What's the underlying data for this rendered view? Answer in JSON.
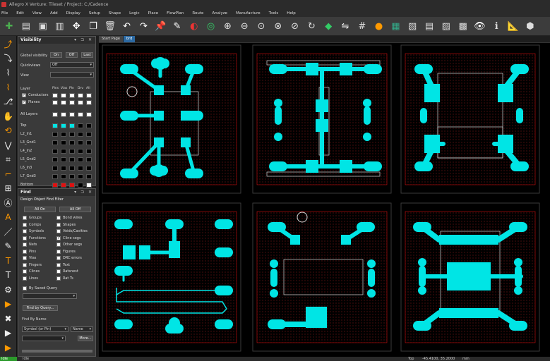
{
  "window": {
    "title": "Allegro X Venture: Tileset / Project: C:/Cadence"
  },
  "menu": [
    "File",
    "Edit",
    "View",
    "Add",
    "Display",
    "Setup",
    "Shape",
    "Logic",
    "Place",
    "FlowPlan",
    "Route",
    "Analyze",
    "Manufacture",
    "Tools",
    "Help"
  ],
  "tabs": [
    {
      "label": "Start Page",
      "active": false
    },
    {
      "label": "brd",
      "active": true
    }
  ],
  "visibility": {
    "title": "Visibility",
    "global_label": "Global visibility",
    "on": "On",
    "off": "Off",
    "last": "Last",
    "quickviews_label": "Quickviews",
    "quickviews_value": "Off",
    "view_label": "View",
    "view_value": "",
    "layer_label": "Layer",
    "cols": [
      "Pins",
      "Vias",
      "Pln",
      "Drv",
      "All"
    ],
    "conductors": "Conductors",
    "planes": "Planes",
    "all_layers": "All Layers",
    "layers": [
      {
        "name": "Top",
        "colors": [
          "#00e5e5",
          "#00e5e5",
          "#00e5e5",
          "#000000",
          "#000000"
        ]
      },
      {
        "name": "L2_In1",
        "colors": [
          "#000000",
          "#000000",
          "#000000",
          "#000000",
          "#000000"
        ]
      },
      {
        "name": "L3_Gnd1",
        "colors": [
          "#000000",
          "#000000",
          "#000000",
          "#000000",
          "#000000"
        ]
      },
      {
        "name": "L4_In2",
        "colors": [
          "#000000",
          "#000000",
          "#000000",
          "#000000",
          "#000000"
        ]
      },
      {
        "name": "L5_Gnd2",
        "colors": [
          "#000000",
          "#000000",
          "#000000",
          "#000000",
          "#000000"
        ]
      },
      {
        "name": "L6_In3",
        "colors": [
          "#000000",
          "#000000",
          "#000000",
          "#000000",
          "#000000"
        ]
      },
      {
        "name": "L7_Gnd3",
        "colors": [
          "#000000",
          "#000000",
          "#000000",
          "#000000",
          "#000000"
        ]
      },
      {
        "name": "Bottom",
        "colors": [
          "#e01010",
          "#e01010",
          "#e01010",
          "#000000",
          "#ffffff"
        ]
      }
    ]
  },
  "find": {
    "title": "Find",
    "filter_title": "Design Object Find Filter",
    "all_on": "All On",
    "all_off": "All Off",
    "left": [
      "Groups",
      "Comps",
      "Symbols",
      "Functions",
      "Nets",
      "Pins",
      "Vias",
      "Fingers",
      "Clines",
      "Lines"
    ],
    "right": [
      "Bond wires",
      "Shapes",
      "Voids/Cavities",
      "Cline segs",
      "Other segs",
      "Figures",
      "DRC errors",
      "Text",
      "Ratsnest",
      "Rat Ts"
    ],
    "right_checked": [
      false,
      false,
      false,
      true,
      false,
      false,
      false,
      false,
      false,
      false
    ],
    "saved_query": "By Saved Query",
    "find_by_query": "Find by Query...",
    "find_by_name": "Find By Name",
    "name_type": "Symbol (or Pin)",
    "name_mode": "Name",
    "more": "More..."
  },
  "status": {
    "state": "Idle",
    "cmd": "Idle",
    "mode": "Top",
    "coords": "-45.4100, 35.2000",
    "units": "mm"
  },
  "colors": {
    "pad": "#00e5e5",
    "outline": "#d8d8d8",
    "boundary": "#d01010",
    "hatch": "#7a1515"
  }
}
